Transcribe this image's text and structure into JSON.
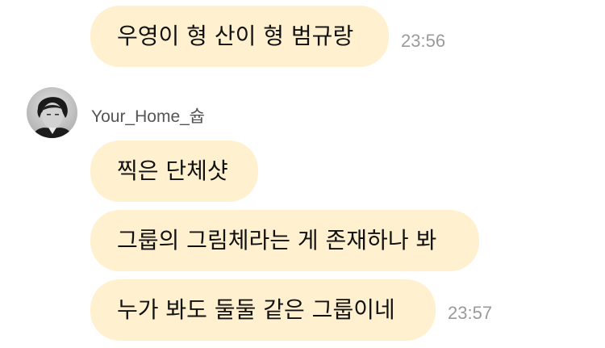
{
  "chat": {
    "messages_top": [
      {
        "text": "우영이 형 산이 형 범규랑",
        "time": "23:56"
      }
    ],
    "sender": {
      "name": "Your_Home_슙",
      "avatar_icon": "profile-photo-avatar"
    },
    "messages_group": [
      {
        "text": "찍은 단체샷"
      },
      {
        "text": "그룹의 그림체라는 게 존재하나 봐"
      },
      {
        "text": "누가 봐도 둘둘 같은 그룹이네",
        "time": "23:57"
      }
    ]
  },
  "colors": {
    "bubble": "#fff1d0",
    "time": "#9a9a9a",
    "background": "#ffffff"
  }
}
